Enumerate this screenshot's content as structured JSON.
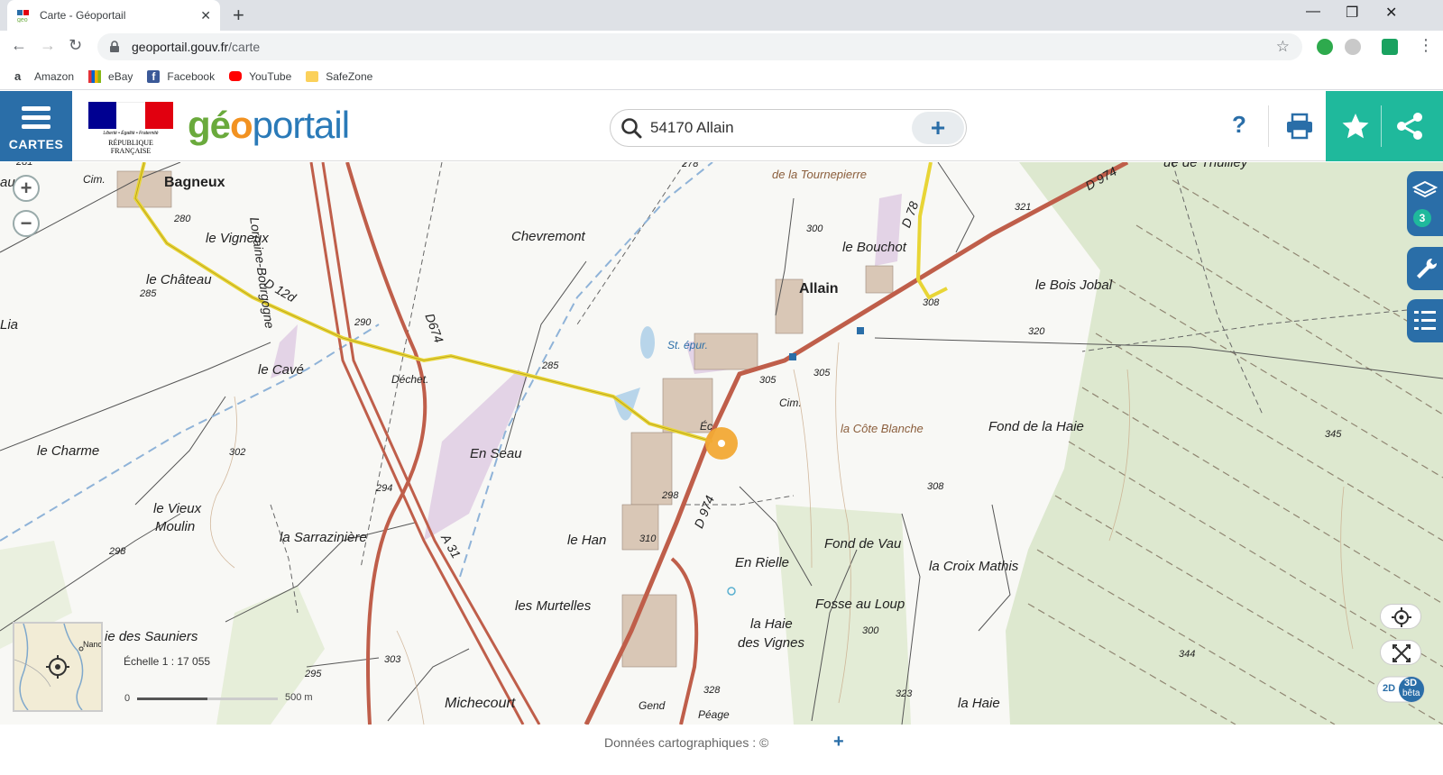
{
  "browser": {
    "tab_title": "Carte - Géoportail",
    "new_tab_icon": "plus-icon",
    "url_domain": "geoportail.gouv.fr",
    "url_path": "/carte",
    "bookmarks": [
      {
        "label": "Amazon",
        "icon": "amazon-icon",
        "color": "#222222"
      },
      {
        "label": "eBay",
        "icon": "ebay-icon",
        "color": "#e53238"
      },
      {
        "label": "Facebook",
        "icon": "facebook-icon",
        "color": "#3b5998"
      },
      {
        "label": "YouTube",
        "icon": "youtube-icon",
        "color": "#ff0000"
      },
      {
        "label": "SafeZone",
        "icon": "folder-icon",
        "color": "#fbd15b"
      }
    ]
  },
  "header": {
    "menu_label": "CARTES",
    "logo_parts": [
      "gé",
      "o",
      "portail"
    ],
    "rf_motto": "Liberté • Égalité • Fraternité",
    "rf_name": "RÉPUBLIQUE FRANÇAISE",
    "search_value": "54170 Allain",
    "help_label": "?",
    "colors": {
      "primary": "#2a6ea8",
      "teal": "#1fb99c",
      "logo_green": "#6aaa3c",
      "logo_orange": "#f29221"
    }
  },
  "map": {
    "layer_count": "3",
    "scale_label": "Échelle 1 : 17 055",
    "scale_start": "0",
    "scale_end": "500 m",
    "minimap_label": "Nanc",
    "mode_2d": "2D",
    "mode_3d": "3D",
    "mode_3d_sub": "bêta",
    "labels": {
      "bagneux": "Bagneux",
      "allain": "Allain",
      "vigneux": "le Vigneux",
      "chateau": "le Château",
      "cave": "le Cavé",
      "charme": "le Charme",
      "vieux_moulin_1": "le Vieux",
      "vieux_moulin_2": "Moulin",
      "sarraziniere": "la Sarrazinière",
      "sauniers": "ie des Sauniers",
      "michecourt": "Michecourt",
      "chevremont": "Chevremont",
      "en_seau": "En Seau",
      "le_han": "le Han",
      "murtelles": "les Murtelles",
      "en_rielle": "En Rielle",
      "haie_vignes_1": "la Haie",
      "haie_vignes_2": "des Vignes",
      "fosse_loup": "Fosse au Loup",
      "fond_vau": "Fond de Vau",
      "croix_mathis": "la Croix Mathis",
      "fond_haie": "Fond de la Haie",
      "cote_blanche": "la Côte Blanche",
      "bois_jobal": "le Bois Jobal",
      "bouchot": "le Bouchot",
      "tournepierre": "de la Tournepierre",
      "thuilley": "ue de Thuilley",
      "la_haie": "la Haie",
      "lorraine": "Lorraine-Bourgogne",
      "d12d": "D 12d",
      "d674": "D674",
      "d974_a": "D 974",
      "d974_b": "D 974",
      "d78": "D 78",
      "a31": "A 31",
      "st_epur": "St. épur.",
      "dechet": "Déchet.",
      "cim1": "Cim.",
      "cim2": "Cim.",
      "ec": "Éc",
      "gend": "Gend",
      "peage": "Péage",
      "lia": "Lia",
      "au": "au",
      "a_right": "A"
    },
    "altitudes": {
      "a280": "280",
      "a285a": "285",
      "a290": "290",
      "a285b": "285",
      "a294": "294",
      "a298a": "298",
      "a302": "302",
      "a295": "295",
      "a303": "303",
      "a298b": "298",
      "a310": "310",
      "a305a": "305",
      "a305b": "305",
      "a300a": "300",
      "a308a": "308",
      "a320": "320",
      "a321": "321",
      "a308b": "308",
      "a345": "345",
      "a344": "344",
      "a323": "323",
      "a300b": "300",
      "a328": "328",
      "a278": "278",
      "a281": "281"
    }
  },
  "footer": {
    "credit": "Données cartographiques : ©",
    "more_label": "+"
  }
}
